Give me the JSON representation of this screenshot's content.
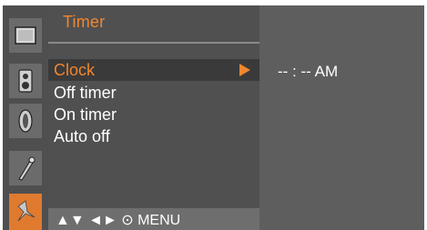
{
  "menu": {
    "title": "Timer",
    "items": [
      {
        "label": "Clock",
        "selected": true
      },
      {
        "label": "Off timer"
      },
      {
        "label": "On timer"
      },
      {
        "label": "Auto off"
      }
    ],
    "footer": "▲▼ ◄► ⊙ MENU"
  },
  "value_panel": {
    "clock_value": "-- : -- AM"
  },
  "sidebar": {
    "icons": [
      "picture-icon",
      "audio-icon",
      "screen-icon",
      "special-icon",
      "timer-icon"
    ],
    "active_icon": "timer-icon"
  },
  "colors": {
    "accent": "#f0862f",
    "active_tile": "#e07a2f"
  }
}
